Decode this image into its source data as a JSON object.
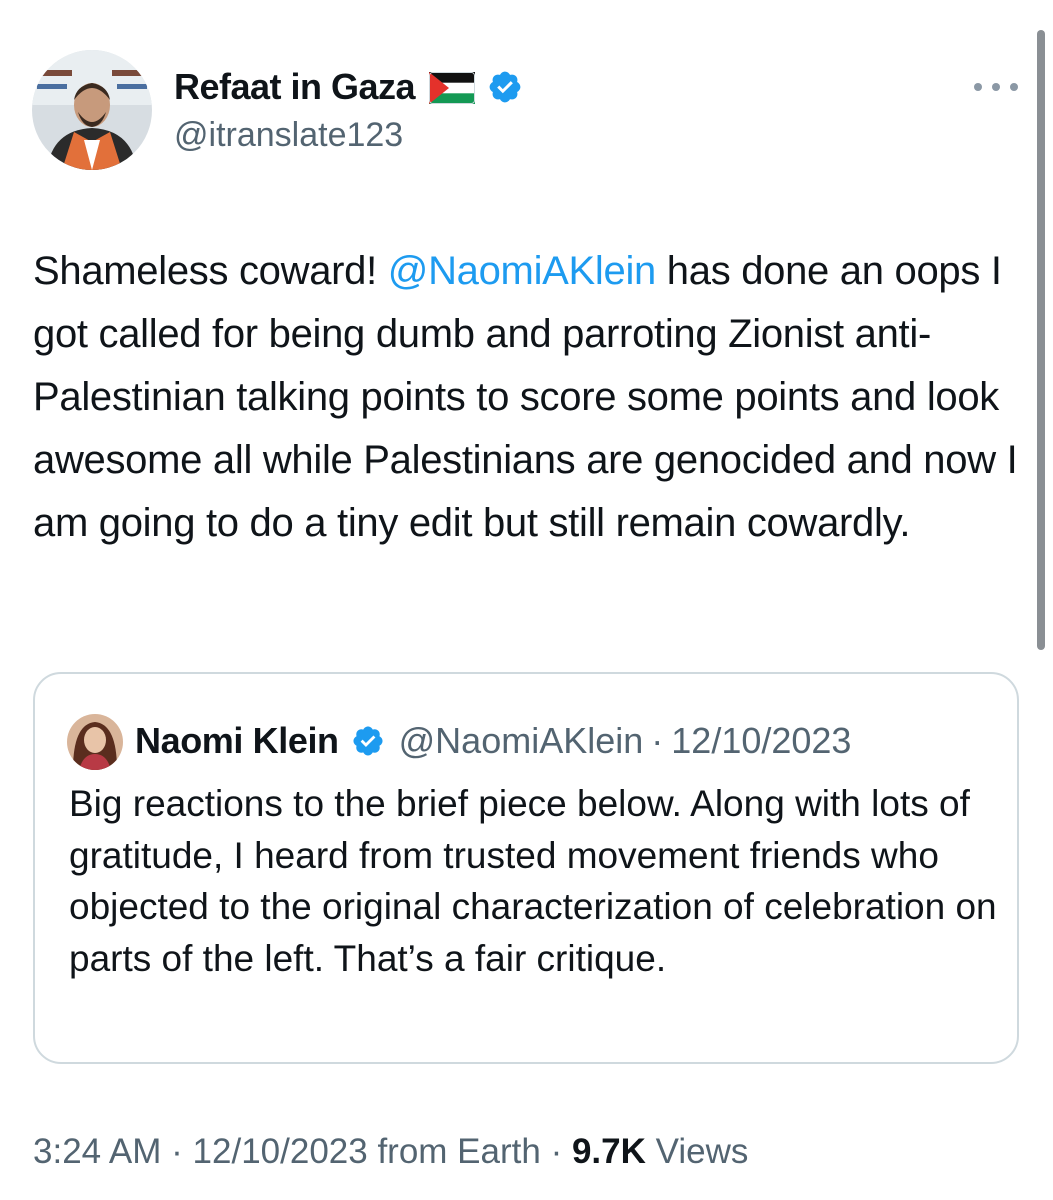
{
  "author": {
    "display_name": "Refaat in Gaza",
    "handle": "@itranslate123",
    "verified": true,
    "flag": "palestine-flag"
  },
  "tweet": {
    "text_prefix": "Shameless coward! ",
    "mention": "@NaomiAKlein",
    "text_suffix": " has done an oops I got called for being dumb and parroting Zionist anti-Palestinian talking points to score some points and look awesome all while Palestinians are genocided and now I am going to do a tiny edit but still remain cowardly."
  },
  "quoted_tweet": {
    "display_name": "Naomi Klein",
    "handle": "@NaomiAKlein",
    "separator": "·",
    "date": "12/10/2023",
    "text": "Big reactions to the brief piece below. Along with lots of gratitude, I heard from trusted movement friends who objected to the original characterization of celebration on parts of the left. That’s a fair critique."
  },
  "meta": {
    "time": "3:24 AM",
    "separator": "·",
    "date": "12/10/2023",
    "source": "from Earth",
    "views_count": "9.7K",
    "views_label": "Views"
  },
  "colors": {
    "link": "#1d9bf0",
    "muted": "#536471",
    "text": "#0f1419",
    "border": "#cfd9de"
  },
  "icons": [
    "more-icon",
    "verified-badge-icon",
    "palestine-flag-icon"
  ]
}
